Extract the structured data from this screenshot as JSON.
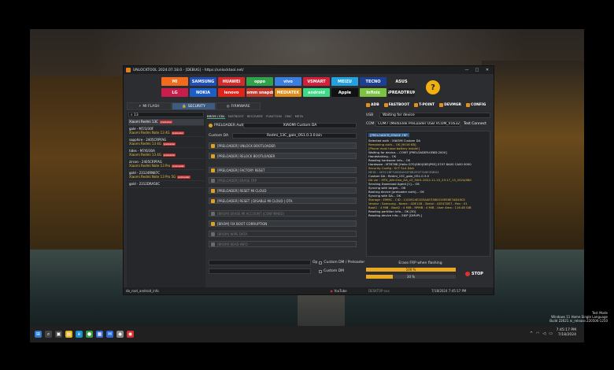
{
  "window": {
    "title": "UNLOCKTOOL 2024.07.18.0 - [DEBUG] - https://unlocktool.net/",
    "controls": [
      "—",
      "□",
      "✕"
    ]
  },
  "brands": [
    {
      "label": "MI",
      "color": "#f26a1b"
    },
    {
      "label": "SAMSUNG",
      "color": "#1f4fb8"
    },
    {
      "label": "HUAWEI",
      "color": "#d42a2a"
    },
    {
      "label": "oppo",
      "color": "#2fa34a"
    },
    {
      "label": "vivo",
      "color": "#3a7ee0"
    },
    {
      "label": "VSMART",
      "color": "#d21f3a"
    },
    {
      "label": "MEIZU",
      "color": "#22a0e0"
    },
    {
      "label": "TECNO",
      "color": "#1c3f94"
    },
    {
      "label": "ASUS",
      "color": "#2d2d2d"
    },
    {
      "label": "LG",
      "color": "#c91e4b"
    },
    {
      "label": "NOKIA",
      "color": "#1b5ec8"
    },
    {
      "label": "lenovo",
      "color": "#e2231a"
    },
    {
      "label": "Qualcomm snapdragon",
      "color": "#c0392b"
    },
    {
      "label": "MEDIATEK",
      "color": "#e08a1a"
    },
    {
      "label": "android",
      "color": "#3ddc84"
    },
    {
      "label": "Apple",
      "color": "#111111"
    },
    {
      "label": "Infinix",
      "color": "#7cc242"
    },
    {
      "label": "SPREADTRUM",
      "color": "#222222"
    }
  ],
  "left": {
    "tabs": [
      "MI FLASH",
      "SECURITY",
      "FIRMWARE"
    ],
    "search_value": "13",
    "models": [
      {
        "name": "Xiaomi Redmi 13C",
        "badge": "preloader"
      },
      {
        "code": "gale - M7/3/30F",
        "name": "Xiaomi Redmi Note 13 4G",
        "badge": "preloader"
      },
      {
        "code": "sapphire - 2405CRPFAG",
        "name": "Xiaomi Redmi 13 4G",
        "badge": "preloader"
      },
      {
        "code": "tides - M7/6/30A",
        "name": "Xiaomi Redmi 13 4G",
        "badge": "preloader"
      },
      {
        "code": "zircon - 2405CRPFAG",
        "name": "Xiaomi Redmi Note 13 Pro",
        "badge": "preloader"
      },
      {
        "code": "gold - 23124RN87C",
        "name": "Xiaomi Redmi Note 13 Pro 5G",
        "badge": "preloader"
      },
      {
        "code": "gold - 2312DRA50C",
        "name": "",
        "badge": ""
      }
    ]
  },
  "middle": {
    "subtabs": [
      "BROM / EDL",
      "FASTBOOT",
      "RECOVERY",
      "FUNCTION",
      "OMC",
      "META"
    ],
    "preloader_auth_label": "PRELOADER Auth",
    "preloader_auth_value": "XIAOMI Custom DA",
    "custom_da_label": "Custom DA",
    "custom_da_value": "Redmi_13C_gale_OS1.0.3.0.bin",
    "buttons": [
      {
        "label": "[PRELOADER] UNLOCK BOOTLOADER",
        "enabled": true
      },
      {
        "label": "[PRELOADER] RELOCK BOOTLOADER",
        "enabled": true
      },
      {
        "label": "[PRELOADER] FACTORY RESET",
        "enabled": true
      },
      {
        "label": "[PRELOADER] ERASE FRP",
        "enabled": false
      },
      {
        "label": "[PRELOADER] RESET MI CLOUD",
        "enabled": true
      },
      {
        "label": "[PRELOADER] RESET | DISABLE MI CLOUD | OTA",
        "enabled": true
      },
      {
        "label": "[BROM] ERASE MI ACCOUNT (CONFIRMED)",
        "enabled": false
      },
      {
        "label": "[BROM] FIX BOOT CORRUPTION",
        "enabled": true
      },
      {
        "label": "[BROM] WIPE DATA",
        "enabled": false
      },
      {
        "label": "[BROM] READ INFO",
        "enabled": false
      }
    ],
    "checkbox_custom_dm_label": "Custom DM / Preloader",
    "checkbox_custom_da_label": "Custom DM",
    "op_label": "Op"
  },
  "right": {
    "toolbar": [
      "ADB",
      "FASTBOOT",
      "T-POINT",
      "DEVMGR",
      "CONFIG"
    ],
    "usb_label": "USB",
    "usb_value": "Waiting for device",
    "com_label": "COM",
    "com_value": "COM7 (MediaTek PreLoader USB VCOM_V1632 (Android))",
    "com_action": "Test Connect",
    "log_header": "[PRELOADER] ERASE FRP",
    "log": [
      {
        "t": "Selected auth : XIAOMI Custom DA",
        "c": "#eaeaea"
      },
      {
        "t": "  Remaining auth... OK [9016 KB]",
        "c": "#e8c040"
      },
      {
        "t": "[Phone must have battery inside!]",
        "c": "#e8c040"
      },
      {
        "t": "Waiting for device... COM7 [PRELOADER:0E8D:2000]",
        "c": "#eaeaea"
      },
      {
        "t": "Handshaking... OK",
        "c": "#eaeaea"
      },
      {
        "t": "Reading hardware info... OK",
        "c": "#eaeaea"
      },
      {
        "t": "  Hardware : MT6768 [Helio G70|G80|G85|P65] 0707 8A00 CA00 0000",
        "c": "#eaeaea"
      },
      {
        "t": "  Security Config : SCT SLA DAA",
        "c": "#e8c040"
      },
      {
        "t": "  MEID : 4E5C18F3280DA92F8B2E9F7A9E2DB04",
        "c": "#9aa"
      },
      {
        "t": "Custom DA : Redmi_13C_gale_OS1.0.3.0",
        "c": "#eaeaea"
      },
      {
        "t": "DA ver : MTK_AllInOne_DA_v3_3001.2022-11-15_23:17_13_2024/080",
        "c": "#e8c040"
      },
      {
        "t": "Sending Download Agent [1]... OK",
        "c": "#eaeaea"
      },
      {
        "t": "Syncing with target... OK",
        "c": "#eaeaea"
      },
      {
        "t": "Booting device [preloader auth]... OK",
        "c": "#eaeaea"
      },
      {
        "t": "Syncing with DA... OK",
        "c": "#eaeaea"
      },
      {
        "t": "  Storage : EMMC - CID : 1100524E1D3A4E3380019EE6E7AD4902",
        "c": "#e8c040"
      },
      {
        "t": "  Vendor : Samsung - Name : 4DE128 - Serial : 42E47DE7 - Rev : 01",
        "c": "#e8c040"
      },
      {
        "t": "  Boot1 : 4 MiB - Boot2 : 4 MiB - RPMB : 4 MiB - User Area : 116.48 GiB",
        "c": "#e8c040"
      },
      {
        "t": "Reading partition info... OK [30]",
        "c": "#eaeaea"
      },
      {
        "t": "Reading device info... SKIP [DMVPL]",
        "c": "#eaeaea"
      }
    ],
    "progress_caption": "Erase FRP when flashing",
    "progress1": {
      "label": "100 %",
      "value": 1.0
    },
    "progress2": {
      "label": "30 %",
      "value": 0.3
    },
    "stop_label": "STOP"
  },
  "status": {
    "user": "da_root_android_info",
    "youtube": "YouTube",
    "pc": "DESKTOP-xxx",
    "time": "7/18/2024 7:45:17 PM"
  },
  "taskbar": {
    "icons": [
      {
        "name": "windows-start-icon",
        "glyph": "⊞",
        "color": "#2a7ad6"
      },
      {
        "name": "search-icon",
        "glyph": "⌕",
        "color": "#444"
      },
      {
        "name": "task-view-icon",
        "glyph": "▣",
        "color": "#444"
      },
      {
        "name": "file-explorer-icon",
        "glyph": "▤",
        "color": "#e8b020"
      },
      {
        "name": "edge-icon",
        "glyph": "e",
        "color": "#1a8fd6"
      },
      {
        "name": "chrome-icon",
        "glyph": "●",
        "color": "#3a9a4a"
      },
      {
        "name": "store-icon",
        "glyph": "▦",
        "color": "#3a6ad6"
      },
      {
        "name": "mail-icon",
        "glyph": "✉",
        "color": "#2a6ad6"
      },
      {
        "name": "app-icon",
        "glyph": "◆",
        "color": "#888"
      },
      {
        "name": "unlocktool-icon",
        "glyph": "◉",
        "color": "#d03030"
      }
    ],
    "clock_time": "7:45:17 PM",
    "clock_date": "7/18/2024"
  },
  "watermark": {
    "line1": "Test Mode",
    "line2": "Windows 11 Home Single Language",
    "line3": "Build 22621.ni_release.220506-1250"
  }
}
